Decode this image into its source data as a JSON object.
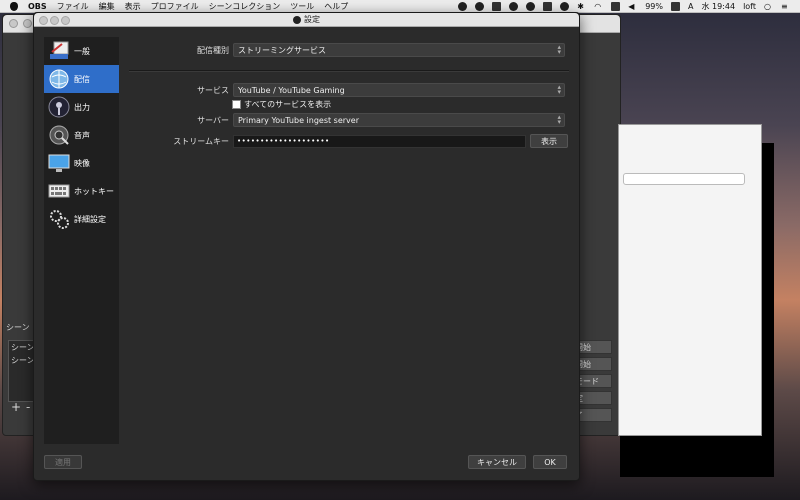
{
  "menubar": {
    "app_name": "OBS",
    "items": [
      "ファイル",
      "編集",
      "表示",
      "プロファイル",
      "シーンコレクション",
      "ツール",
      "ヘルプ"
    ],
    "battery": "99%",
    "input_source": "A",
    "clock": "水 19:44",
    "user": "loft"
  },
  "background_window": {
    "scene_panel_title": "シーン",
    "scene_items": [
      "シーン",
      "シーン"
    ],
    "add_symbol": "+",
    "remove_symbol": "-",
    "control_buttons": [
      "開始",
      "開始",
      "モード",
      "定",
      "了"
    ]
  },
  "settings": {
    "title": "設定",
    "sidebar": [
      {
        "label": "一般",
        "icon": "general-icon"
      },
      {
        "label": "配信",
        "icon": "stream-globe-icon"
      },
      {
        "label": "出力",
        "icon": "output-icon"
      },
      {
        "label": "音声",
        "icon": "audio-icon"
      },
      {
        "label": "映像",
        "icon": "video-monitor-icon"
      },
      {
        "label": "ホットキー",
        "icon": "keyboard-icon"
      },
      {
        "label": "詳細設定",
        "icon": "gears-icon"
      }
    ],
    "active_index": 1,
    "stream": {
      "type_label": "配信種別",
      "type_value": "ストリーミングサービス",
      "service_label": "サービス",
      "service_value": "YouTube / YouTube Gaming",
      "show_all_label": "すべてのサービスを表示",
      "server_label": "サーバー",
      "server_value": "Primary YouTube ingest server",
      "key_label": "ストリームキー",
      "key_value": "••••••••••••••••••••",
      "show_button": "表示"
    },
    "footer": {
      "apply": "適用",
      "cancel": "キャンセル",
      "ok": "OK"
    }
  },
  "colors": {
    "accent": "#2f6ec9",
    "panel": "#2b2b2b",
    "sidebar": "#1f1f1f"
  }
}
